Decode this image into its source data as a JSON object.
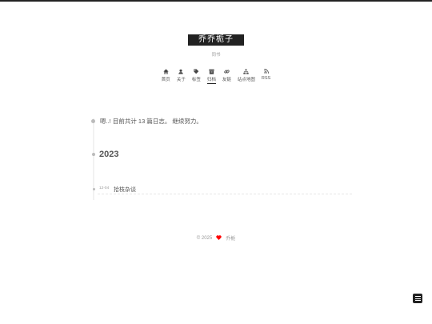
{
  "site": {
    "title": "乔乔栀子",
    "subtitle": "同书"
  },
  "menu": [
    {
      "label": "首页",
      "icon": "home-icon"
    },
    {
      "label": "关于",
      "icon": "user-icon"
    },
    {
      "label": "标签",
      "icon": "tags-icon"
    },
    {
      "label": "归档",
      "icon": "archive-icon",
      "active": true
    },
    {
      "label": "友链",
      "icon": "link-icon"
    },
    {
      "label": "站点地图",
      "icon": "sitemap-icon"
    },
    {
      "label": "RSS",
      "icon": "rss-icon"
    }
  ],
  "archive": {
    "collection_title": "嗯..! 目前共计 13 篇日志。 继续努力。",
    "year": "2023",
    "posts": [
      {
        "date": "12-04",
        "title": "拾枝杂谈"
      }
    ]
  },
  "footer": {
    "copyright": "© 2025",
    "author": "乔栀"
  },
  "colors": {
    "accent": "#222222",
    "heart": "#ff0000",
    "text": "#555555",
    "muted": "#999999"
  }
}
